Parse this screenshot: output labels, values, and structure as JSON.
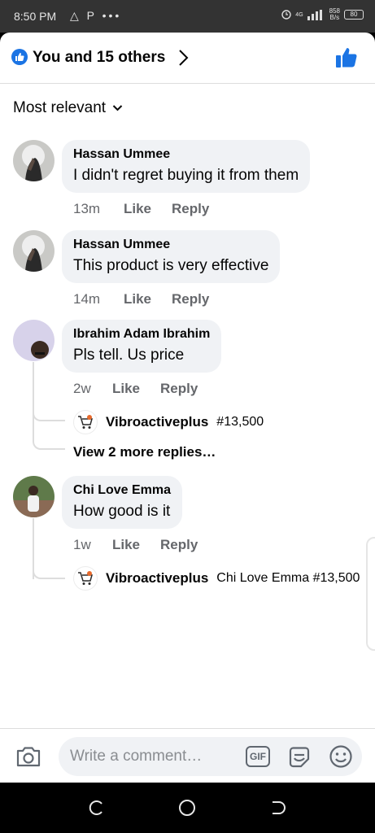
{
  "status_bar": {
    "time": "8:50 PM",
    "left_icons": "△ P •••",
    "network": "4G",
    "speed_value": "858",
    "speed_unit": "B/s",
    "battery": "80"
  },
  "reactions": {
    "summary": "You and 15 others",
    "icon": "like-icon"
  },
  "sort": {
    "label": "Most relevant"
  },
  "comments": [
    {
      "author": "Hassan Ummee",
      "text": "I didn't regret buying it from them",
      "time": "13m",
      "like_label": "Like",
      "reply_label": "Reply"
    },
    {
      "author": "Hassan Ummee",
      "text": "This product is very effective",
      "time": "14m",
      "like_label": "Like",
      "reply_label": "Reply"
    },
    {
      "author": "Ibrahim Adam Ibrahim",
      "text": "Pls tell. Us price",
      "time": "2w",
      "like_label": "Like",
      "reply_label": "Reply",
      "reply_preview": {
        "author": "Vibroactiveplus",
        "text": "#13,500"
      },
      "more_replies": "View 2 more replies…"
    },
    {
      "author": "Chi Love Emma",
      "text": "How good is it",
      "time": "1w",
      "like_label": "Like",
      "reply_label": "Reply",
      "reply_preview": {
        "author": "Vibroactiveplus",
        "text": "Chi Love Emma #13,500"
      }
    }
  ],
  "composer": {
    "placeholder": "Write a comment…",
    "gif_label": "GIF"
  },
  "colors": {
    "accent": "#1b74e4",
    "bubble": "#f0f2f5",
    "meta_text": "#65676b"
  }
}
